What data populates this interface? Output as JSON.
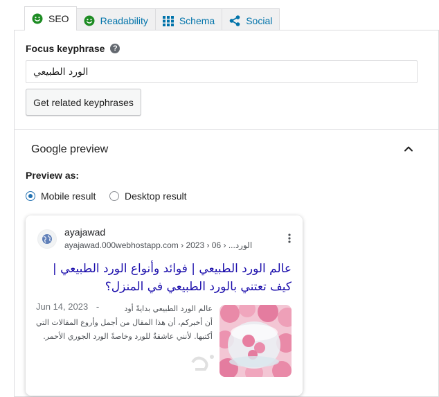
{
  "tabs": [
    {
      "label": "SEO",
      "icon": "smiley-green-icon",
      "active": true
    },
    {
      "label": "Readability",
      "icon": "smiley-green-icon",
      "active": false
    },
    {
      "label": "Schema",
      "icon": "grid-icon",
      "active": false
    },
    {
      "label": "Social",
      "icon": "share-icon",
      "active": false
    }
  ],
  "focus": {
    "label": "Focus keyphrase",
    "value": "الورد الطبيعي",
    "related_button": "Get related keyphrases"
  },
  "google_preview": {
    "title": "Google preview",
    "preview_as_label": "Preview as:",
    "options": [
      {
        "label": "Mobile result",
        "selected": true
      },
      {
        "label": "Desktop result",
        "selected": false
      }
    ]
  },
  "result": {
    "site_name": "ayajawad",
    "url": "ayajawad.000webhostapp.com › 2023 › 06 › ...الورد",
    "title": "عالم الورد الطبيعي | فوائد وأنواع الورد الطبيعي | كيف تعتني بالورد الطبيعي في المنزل؟",
    "date": "Jun 14, 2023",
    "date_sep": "-",
    "snippet": "عالم الورد الطبيعي بدايةً أود أن أخبركم، أن هذا المقال من أجمل وأروع المقالات التي أكتبها. لأنني عاشقةٌ للورد وخاصةً الورد الجوري الأحمر."
  },
  "colors": {
    "link_blue": "#1a0dab",
    "tab_blue": "#0073aa",
    "radio_blue": "#2271b1",
    "smiley_green": "#1e8c24"
  }
}
